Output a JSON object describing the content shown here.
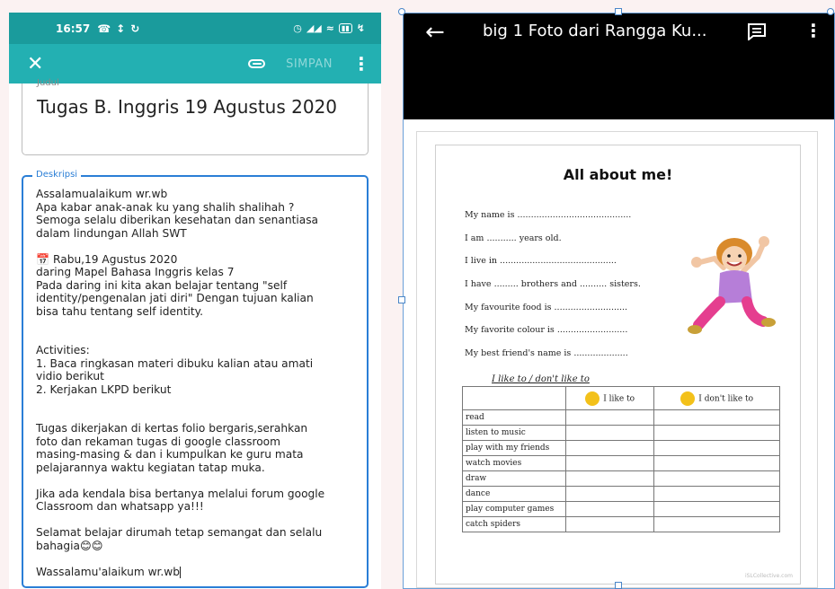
{
  "left_phone": {
    "status_bar": {
      "time": "16:57"
    },
    "app_bar": {
      "save_label": "SIMPAN"
    },
    "title_field": {
      "label": "Judul",
      "value": "Tugas B. Inggris 19 Agustus 2020"
    },
    "description_field": {
      "label": "Deskripsi",
      "value": "Assalamualaikum wr.wb\nApa kabar anak-anak ku yang shalih shalihah ?\nSemoga selalu diberikan kesehatan dan senantiasa\ndalam lindungan Allah SWT\n\n📅 Rabu,19 Agustus 2020\ndaring Mapel Bahasa Inggris kelas 7\nPada daring ini kita akan belajar tentang \"self\nidentity/pengenalan jati diri\" Dengan tujuan kalian\nbisa tahu tentang self identity.\n\n\nActivities:\n1. Baca ringkasan materi dibuku kalian atau amati\nvidio berikut\n2. Kerjakan LKPD berikut\n\n\nTugas dikerjakan di kertas folio bergaris,serahkan\nfoto dan rekaman tugas di google classroom\nmasing-masing & dan i kumpulkan ke guru mata\npelajarannya waktu kegiatan tatap muka.\n\nJika ada kendala bisa bertanya melalui forum google\nClassroom dan whatsapp ya!!!\n\nSelamat belajar dirumah tetap semangat dan selalu\nbahagia😊😊\n\nWassalamu'alaikum wr.wb"
    }
  },
  "right_phone": {
    "viewer_title": "big 1 Foto dari Rangga Ku...",
    "worksheet": {
      "title": "All about me!",
      "lines": [
        "My name is ..........................................",
        "I am ........... years old.",
        "I live in ...........................................",
        "I have ......... brothers and .......... sisters.",
        "My favourite food is ...........................",
        "My favorite colour is ..........................",
        "My best friend's name is ...................."
      ],
      "table_caption": "I like to / don't like to",
      "table_headers": [
        "",
        "I like to",
        "I don't like to"
      ],
      "activities": [
        "read",
        "listen to music",
        "play with my friends",
        "watch movies",
        "draw",
        "dance",
        "play computer games",
        "catch spiders"
      ],
      "site": "iSLCollective.com"
    }
  }
}
